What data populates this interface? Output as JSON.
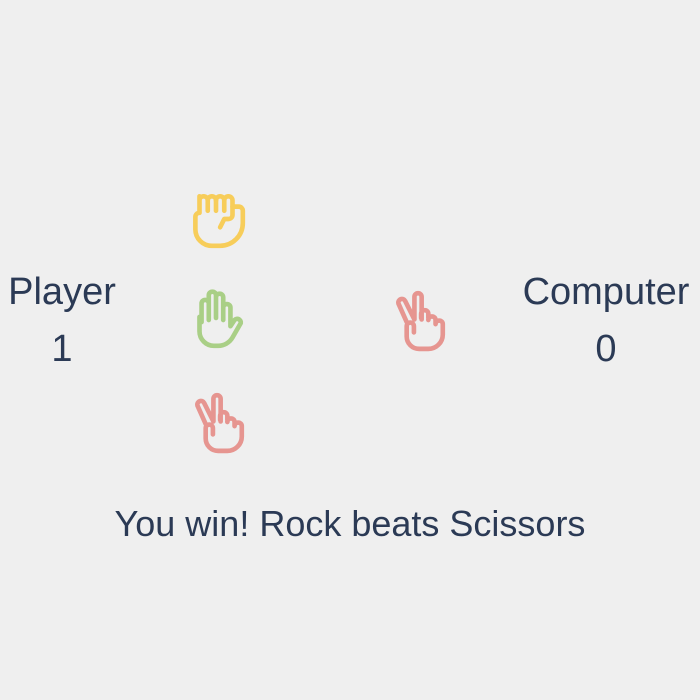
{
  "player": {
    "label": "Player",
    "score": "1"
  },
  "computer": {
    "label": "Computer",
    "score": "0",
    "choice_icon": "scissors-icon"
  },
  "choices": [
    {
      "name": "rock",
      "icon": "fist-icon",
      "color": "#f7cd5a"
    },
    {
      "name": "paper",
      "icon": "open-hand-icon",
      "color": "#a9cf86"
    },
    {
      "name": "scissors",
      "icon": "scissors-hand-icon",
      "color": "#e69590"
    }
  ],
  "result": {
    "message": "You win! Rock beats Scissors"
  },
  "colors": {
    "background": "#efefef",
    "text": "#2b3a55"
  }
}
